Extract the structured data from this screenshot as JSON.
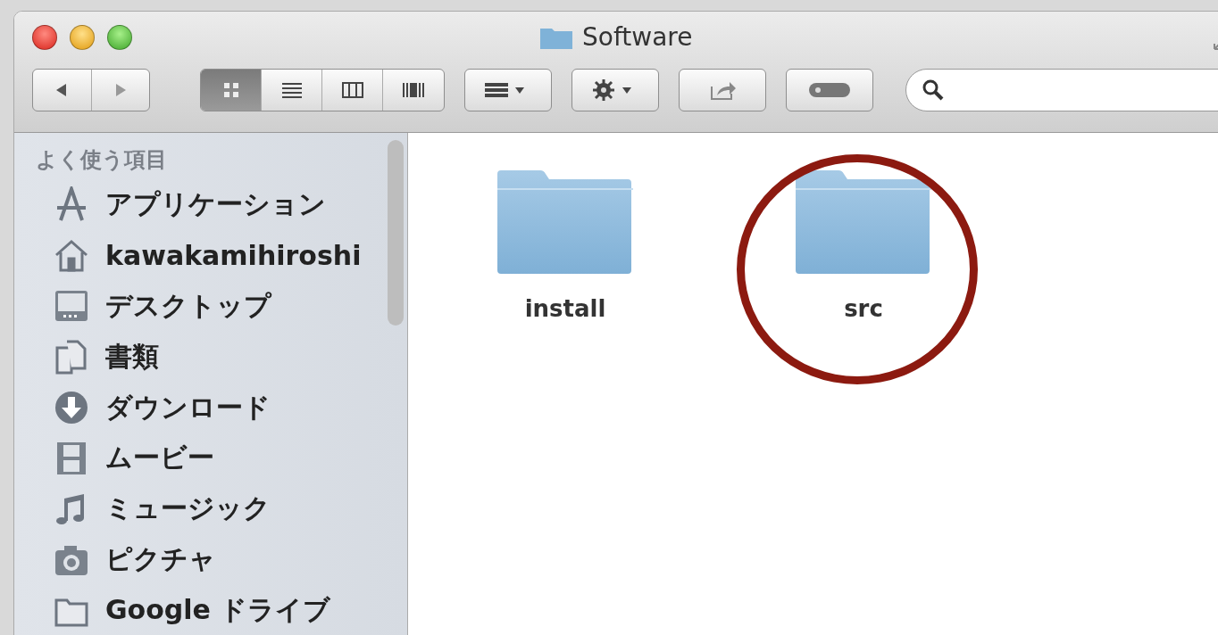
{
  "window": {
    "title": "Software"
  },
  "toolbar": {
    "view_modes": [
      {
        "kind": "icon",
        "selected": true
      },
      {
        "kind": "list",
        "selected": false
      },
      {
        "kind": "columns",
        "selected": false
      },
      {
        "kind": "coverflow",
        "selected": false
      }
    ]
  },
  "sidebar": {
    "heading": "よく使う項目",
    "items": [
      {
        "kind": "apps",
        "label": "アプリケーション"
      },
      {
        "kind": "home",
        "label": "kawakamihiroshi"
      },
      {
        "kind": "desktop",
        "label": "デスクトップ"
      },
      {
        "kind": "documents",
        "label": "書類"
      },
      {
        "kind": "downloads",
        "label": "ダウンロード"
      },
      {
        "kind": "movies",
        "label": "ムービー"
      },
      {
        "kind": "music",
        "label": "ミュージック"
      },
      {
        "kind": "pictures",
        "label": "ピクチャ"
      },
      {
        "kind": "folder",
        "label": "Google ドライブ"
      }
    ]
  },
  "files": [
    {
      "name": "install",
      "circled": false
    },
    {
      "name": "src",
      "circled": true
    }
  ]
}
